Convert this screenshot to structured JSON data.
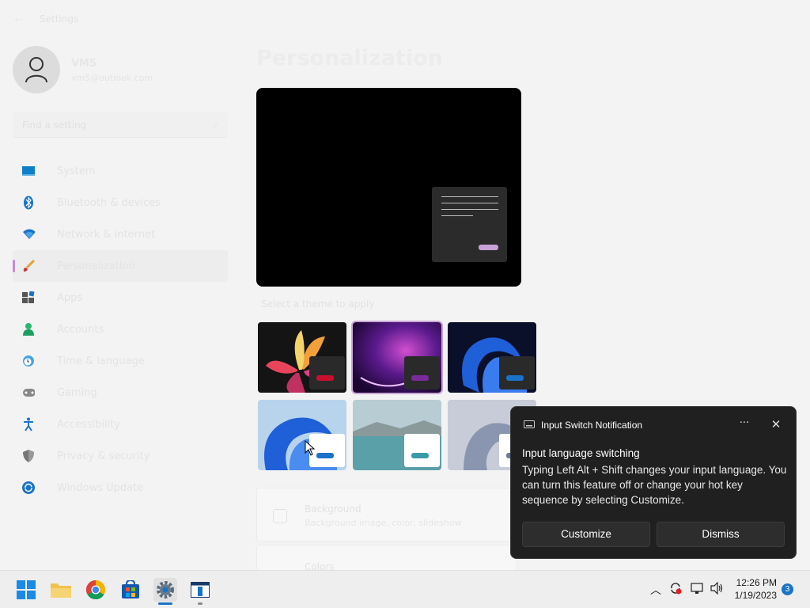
{
  "window": {
    "title": "Settings",
    "back_icon": "back-arrow-icon"
  },
  "user": {
    "name": "VM5",
    "email": "vm5@outlook.com"
  },
  "search": {
    "placeholder": "Find a setting"
  },
  "sidebar": {
    "items": [
      {
        "label": "System",
        "icon": "monitor-icon",
        "selected": false
      },
      {
        "label": "Bluetooth & devices",
        "icon": "bluetooth-icon",
        "selected": false
      },
      {
        "label": "Network & internet",
        "icon": "wifi-icon",
        "selected": false
      },
      {
        "label": "Personalization",
        "icon": "paintbrush-icon",
        "selected": true
      },
      {
        "label": "Apps",
        "icon": "apps-icon",
        "selected": false
      },
      {
        "label": "Accounts",
        "icon": "person-icon",
        "selected": false
      },
      {
        "label": "Time & language",
        "icon": "clock-globe-icon",
        "selected": false
      },
      {
        "label": "Gaming",
        "icon": "gamepad-icon",
        "selected": false
      },
      {
        "label": "Accessibility",
        "icon": "accessibility-icon",
        "selected": false
      },
      {
        "label": "Privacy & security",
        "icon": "shield-icon",
        "selected": false
      },
      {
        "label": "Windows Update",
        "icon": "update-icon",
        "selected": false
      }
    ]
  },
  "main": {
    "title": "Personalization",
    "themes_label": "Select a theme to apply",
    "cards": [
      {
        "title": "Background",
        "subtitle": "Background image, color, slideshow"
      },
      {
        "title": "Colors"
      }
    ]
  },
  "toast": {
    "app_name": "Input Switch Notification",
    "title": "Input language switching",
    "body": "Typing Left Alt + Shift changes your input language. You can turn this feature off or change your hot key sequence by selecting Customize.",
    "customize_label": "Customize",
    "dismiss_label": "Dismiss",
    "more_glyph": "···",
    "close_glyph": "✕"
  },
  "taskbar": {
    "time": "12:26 PM",
    "date": "1/19/2023",
    "notification_count": "3"
  },
  "colors": {
    "accent": "#c48ad6",
    "toast_bg": "#202020",
    "badge": "#1a73c8"
  }
}
